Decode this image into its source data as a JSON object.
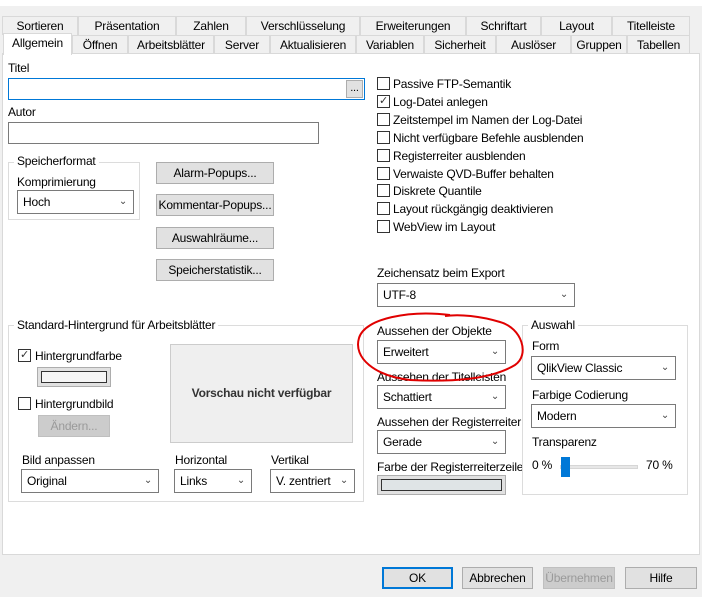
{
  "tabs_row1": [
    "Sortieren",
    "Präsentation",
    "Zahlen",
    "Verschlüsselung",
    "Erweiterungen",
    "Schriftart",
    "Layout",
    "Titelleiste"
  ],
  "tabs_row2": [
    "Allgemein",
    "Öffnen",
    "Arbeitsblätter",
    "Server",
    "Aktualisieren",
    "Variablen",
    "Sicherheit",
    "Auslöser",
    "Gruppen",
    "Tabellen"
  ],
  "general": {
    "title_label": "Titel",
    "title_value": "",
    "browse_label": "...",
    "author_label": "Autor",
    "author_value": "",
    "storage_group": "Speicherformat",
    "compression_label": "Komprimierung",
    "compression_value": "Hoch",
    "buttons": [
      "Alarm-Popups...",
      "Kommentar-Popups...",
      "Auswahlräume...",
      "Speicherstatistik..."
    ]
  },
  "checkboxes": [
    {
      "label": "Passive FTP-Semantik",
      "checked": false
    },
    {
      "label": "Log-Datei anlegen",
      "checked": true
    },
    {
      "label": "Zeitstempel im Namen der Log-Datei",
      "checked": false
    },
    {
      "label": "Nicht verfügbare Befehle ausblenden",
      "checked": false
    },
    {
      "label": "Registerreiter ausblenden",
      "checked": false
    },
    {
      "label": "Verwaiste QVD-Buffer behalten",
      "checked": false
    },
    {
      "label": "Diskrete Quantile",
      "checked": false
    },
    {
      "label": "Layout rückgängig deaktivieren",
      "checked": false
    },
    {
      "label": "WebView im Layout",
      "checked": false
    }
  ],
  "export": {
    "label": "Zeichensatz beim Export",
    "value": "UTF-8"
  },
  "background": {
    "group": "Standard-Hintergrund für Arbeitsblätter",
    "bgcolor_label": "Hintergrundfarbe",
    "bgcolor_checked": true,
    "bgimage_label": "Hintergrundbild",
    "bgimage_checked": false,
    "change_label": "Ändern...",
    "preview": "Vorschau nicht verfügbar",
    "fit_label": "Bild anpassen",
    "fit_value": "Original",
    "horizontal_label": "Horizontal",
    "horizontal_value": "Links",
    "vertical_label": "Vertikal",
    "vertical_value": "V. zentriert"
  },
  "appearance": {
    "objects_label": "Aussehen der Objekte",
    "objects_value": "Erweitert",
    "captions_label": "Aussehen der Titelleisten",
    "captions_value": "Schattiert",
    "tabs_label": "Aussehen der Registerreiter",
    "tabs_value": "Gerade",
    "tabrow_color_label": "Farbe der Registerreiterzeile"
  },
  "selection": {
    "group": "Auswahl",
    "style_label": "Form",
    "style_value": "QlikView Classic",
    "color_label": "Farbige Codierung",
    "color_value": "Modern",
    "transparency_label": "Transparenz",
    "min": "0 %",
    "max": "70 %",
    "transparency_value": 0
  },
  "footer": {
    "ok": "OK",
    "cancel": "Abbrechen",
    "apply": "Übernehmen",
    "help": "Hilfe"
  },
  "colors": {
    "accent": "#0078d7",
    "annotation": "#e00000"
  }
}
